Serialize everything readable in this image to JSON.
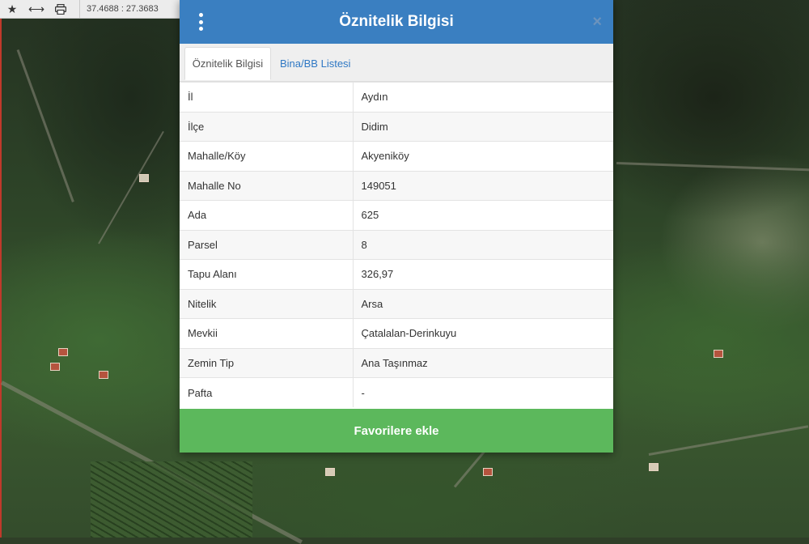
{
  "toolbar": {
    "icons": [
      "star-icon",
      "measure-icon",
      "print-icon"
    ],
    "coordinates": "37.4688 : 27.3683"
  },
  "dialog": {
    "title": "Öznitelik Bilgisi",
    "header_color": "#3a7fc1",
    "tabs": [
      {
        "label": "Öznitelik Bilgisi",
        "active": true
      },
      {
        "label": "Bina/BB Listesi",
        "active": false
      }
    ],
    "rows": [
      {
        "key": "İl",
        "value": "Aydın"
      },
      {
        "key": "İlçe",
        "value": "Didim"
      },
      {
        "key": "Mahalle/Köy",
        "value": "Akyeniköy"
      },
      {
        "key": "Mahalle No",
        "value": "149051"
      },
      {
        "key": "Ada",
        "value": "625"
      },
      {
        "key": "Parsel",
        "value": "8"
      },
      {
        "key": "Tapu Alanı",
        "value": "326,97"
      },
      {
        "key": "Nitelik",
        "value": "Arsa"
      },
      {
        "key": "Mevkii",
        "value": "Çatalalan-Derinkuyu"
      },
      {
        "key": "Zemin Tip",
        "value": "Ana Taşınmaz"
      },
      {
        "key": "Pafta",
        "value": "-"
      }
    ],
    "favorite_button": "Favorilere ekle",
    "favorite_color": "#5cb85c"
  }
}
